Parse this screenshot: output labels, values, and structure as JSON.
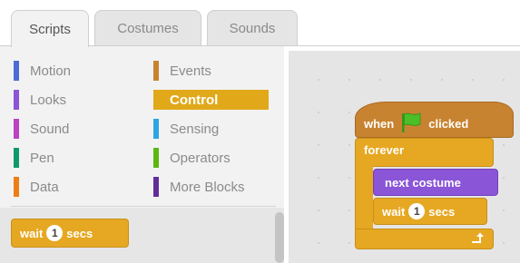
{
  "tabs": [
    {
      "label": "Scripts",
      "active": true
    },
    {
      "label": "Costumes",
      "active": false
    },
    {
      "label": "Sounds",
      "active": false
    }
  ],
  "categories": {
    "left": [
      {
        "label": "Motion",
        "color": "#4a6cd4"
      },
      {
        "label": "Looks",
        "color": "#8a55d7"
      },
      {
        "label": "Sound",
        "color": "#bb42c3"
      },
      {
        "label": "Pen",
        "color": "#0e9a6c"
      },
      {
        "label": "Data",
        "color": "#ee7d16"
      }
    ],
    "right": [
      {
        "label": "Events",
        "color": "#c88330"
      },
      {
        "label": "Control",
        "color": "#e1a91a",
        "selected": true
      },
      {
        "label": "Sensing",
        "color": "#2ca5e2"
      },
      {
        "label": "Operators",
        "color": "#5cb712"
      },
      {
        "label": "More Blocks",
        "color": "#632d99"
      }
    ]
  },
  "palette_blocks": {
    "wait_word": "wait",
    "wait_value": "1",
    "wait_unit": "secs"
  },
  "script": {
    "hat_when": "when",
    "hat_clicked": "clicked",
    "forever": "forever",
    "next_costume": "next costume",
    "wait_word": "wait",
    "wait_value": "1",
    "wait_unit": "secs"
  },
  "colors": {
    "control": "#e6a822",
    "events": "#c88330",
    "looks": "#8a55d7",
    "flag": "#4cbf27"
  }
}
